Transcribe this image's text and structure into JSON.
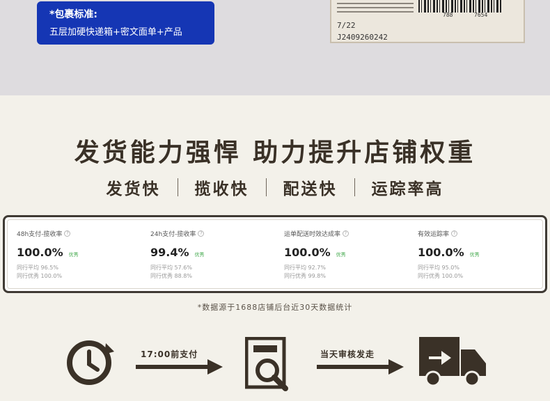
{
  "top_banner": {
    "packaging_title": "*包裹标准:",
    "packaging_desc": "五层加硬快递箱+密文面单+产品",
    "label_numbers": [
      "788",
      "7654"
    ],
    "label_date": "7/22",
    "label_code": "J2409260242"
  },
  "headline": "发货能力强悍 助力提升店铺权重",
  "features": [
    "发货快",
    "揽收快",
    "配送快",
    "运踪率高"
  ],
  "stats": [
    {
      "name": "48h支付-揽收率",
      "value": "100.0%",
      "badge": "优秀",
      "peer_avg": "同行平均 96.5%",
      "peer_best": "同行优秀 100.0%"
    },
    {
      "name": "24h支付-揽收率",
      "value": "99.4%",
      "badge": "优秀",
      "peer_avg": "同行平均 57.6%",
      "peer_best": "同行优秀 88.8%"
    },
    {
      "name": "运单配送时效达成率",
      "value": "100.0%",
      "badge": "优秀",
      "peer_avg": "同行平均 92.7%",
      "peer_best": "同行优秀 99.8%"
    },
    {
      "name": "有效运踪率",
      "value": "100.0%",
      "badge": "优秀",
      "peer_avg": "同行平均 95.0%",
      "peer_best": "同行优秀 100.0%"
    }
  ],
  "data_note": "*数据源于1688店铺后台近30天数据统计",
  "flow": {
    "step1_label": "17:00前支付",
    "step2_label": "当天审核发走"
  },
  "colors": {
    "accent_blue": "#1536b4",
    "icon_dark": "#3a3127",
    "badge_green": "#41a84b"
  }
}
